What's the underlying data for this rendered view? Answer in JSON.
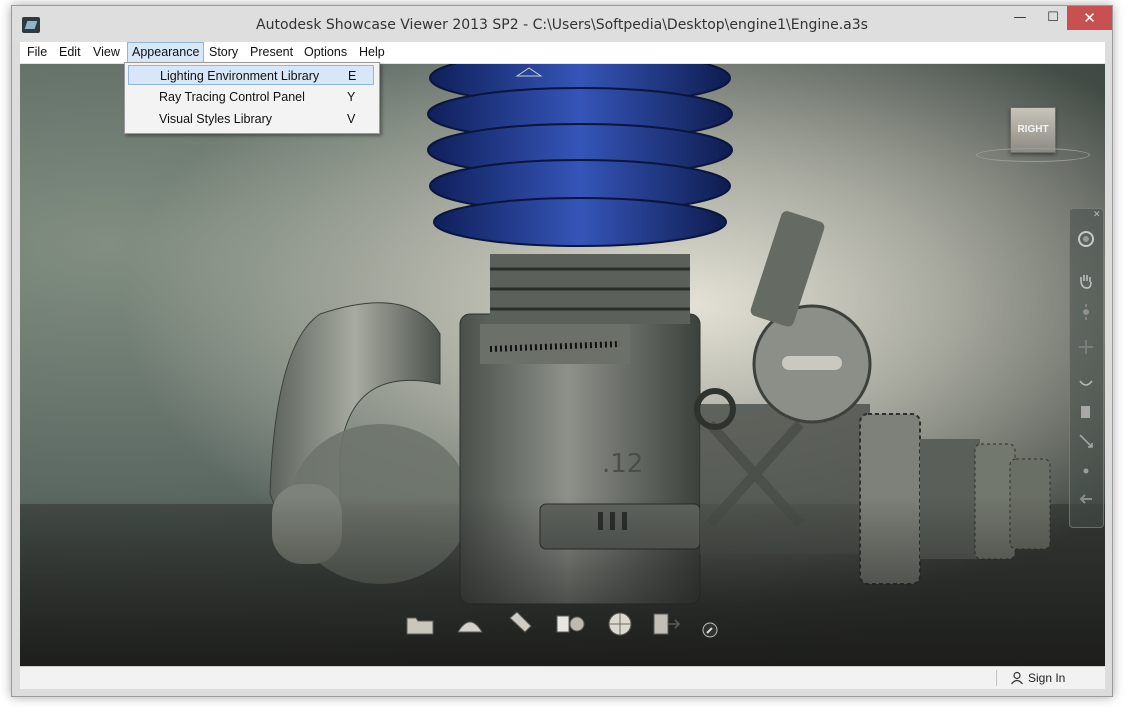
{
  "window": {
    "title": "Autodesk Showcase Viewer 2013 SP2  - C:\\Users\\Softpedia\\Desktop\\engine1\\Engine.a3s"
  },
  "controls": {
    "minimize": "—",
    "maximize": "☐",
    "close": "✕"
  },
  "menubar": [
    "File",
    "Edit",
    "View",
    "Appearance",
    "Story",
    "Present",
    "Options",
    "Help"
  ],
  "active_menu": "Appearance",
  "dropdown": [
    {
      "label": "Lighting Environment Library",
      "key": "E",
      "highlighted": true
    },
    {
      "label": "Ray Tracing Control Panel",
      "key": "Y",
      "highlighted": false
    },
    {
      "label": "Visual Styles Library",
      "key": "V",
      "highlighted": false
    }
  ],
  "viewcube": {
    "label": "RIGHT"
  },
  "model": {
    "stamp": ".12"
  },
  "statusbar": {
    "sign_in": "Sign In"
  },
  "toolbar": [
    "folder-icon",
    "dome-icon",
    "flashlight-icon",
    "materials-icon",
    "sphere-icon",
    "export-icon",
    "wrench-icon"
  ],
  "navigation": [
    "orbit-icon",
    "pan-hand-icon",
    "zoom-icon",
    "walk-icon",
    "center-icon",
    "look-icon",
    "rewind-icon",
    "arrow-back-icon"
  ],
  "colors": {
    "close_button": "#c75050",
    "menu_highlight": "#d8e7f7",
    "cylinder_fins": "#233f93"
  }
}
